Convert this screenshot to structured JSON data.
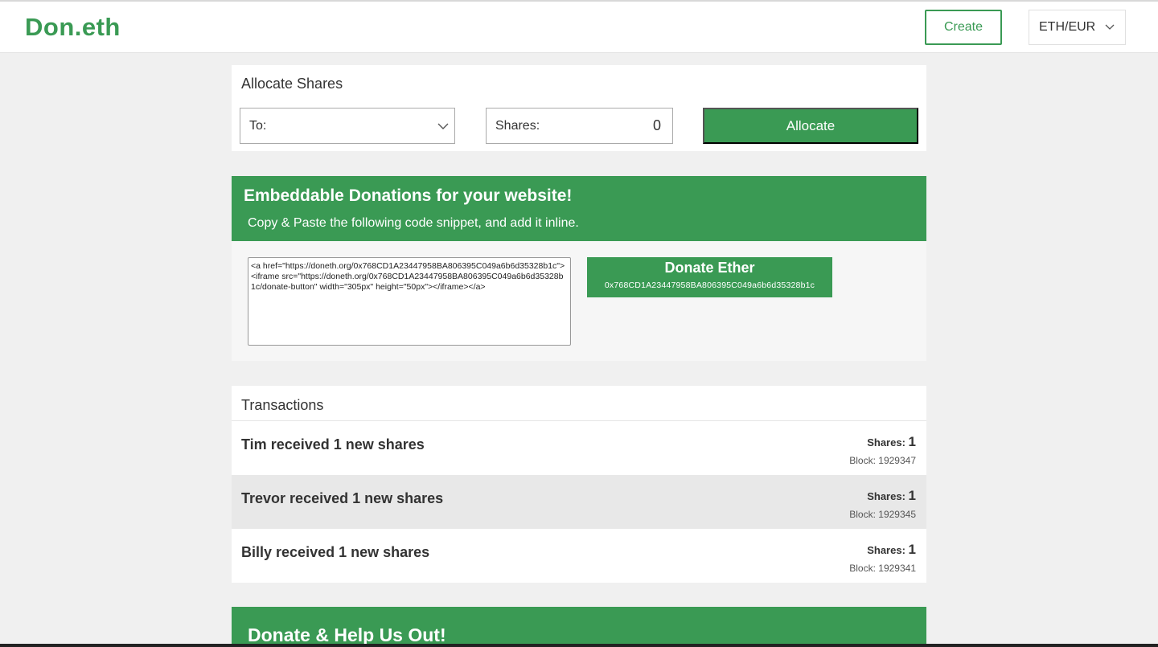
{
  "header": {
    "brand": "Don.eth",
    "create_label": "Create",
    "currency": "ETH/EUR"
  },
  "allocate": {
    "title": "Allocate Shares",
    "to_label": "To:",
    "shares_label": "Shares:",
    "shares_value": "0",
    "button_label": "Allocate"
  },
  "embed": {
    "title": "Embeddable Donations for your website!",
    "subtitle": "Copy & Paste the following code snippet, and add it inline.",
    "code": "<a href=\"https://doneth.org/0x768CD1A23447958BA806395C049a6b6d35328b1c\"><iframe src=\"https://doneth.org/0x768CD1A23447958BA806395C049a6b6d35328b1c/donate-button\" width=\"305px\" height=\"50px\"></iframe></a>",
    "button_title": "Donate Ether",
    "button_address": "0x768CD1A23447958BA806395C049a6b6d35328b1c"
  },
  "transactions": {
    "title": "Transactions",
    "shares_label": "Shares:",
    "rows": [
      {
        "name": "Tim",
        "text": "received 1 new shares",
        "shares": "1",
        "block": "Block: 1929347"
      },
      {
        "name": "Trevor",
        "text": "received 1 new shares",
        "shares": "1",
        "block": "Block: 1929345"
      },
      {
        "name": "Billy",
        "text": "received 1 new shares",
        "shares": "1",
        "block": "Block: 1929341"
      }
    ]
  },
  "help": {
    "title": "Donate & Help Us Out!"
  },
  "colors": {
    "brand_green": "#3a9a54",
    "background": "#f0f0f0"
  }
}
